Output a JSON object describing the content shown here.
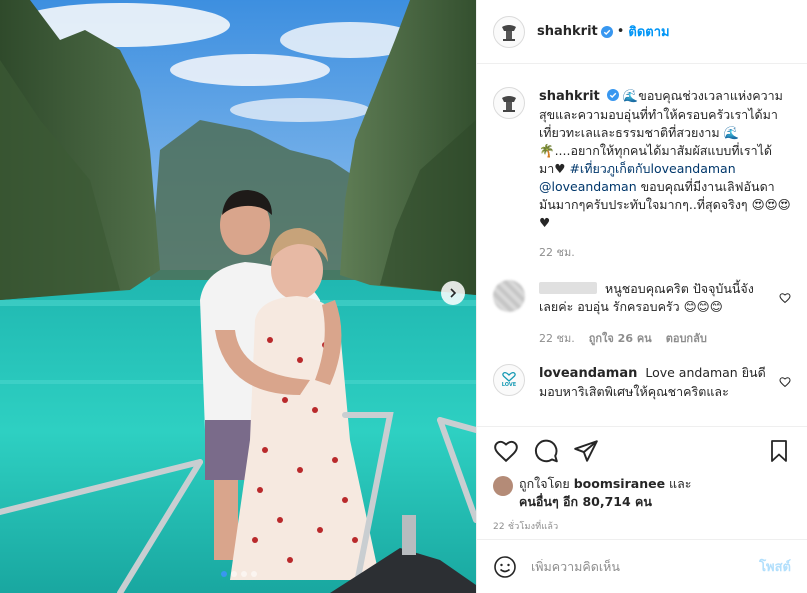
{
  "post": {
    "username": "shahkrit",
    "follow_label": "ติดตาม",
    "separator": "•",
    "caption_line1": "🌊ขอบคุณช่วงเวลาแห่งความสุขและความอบอุ่นที่ทำให้ครอบครัวเราได้มาเที่ยวทะเลและธรรมชาติที่สวยงาม",
    "caption_line2": "🌊🌴....อยากให้ทุกคนได้มาสัมผัสแบบที่เราได้มา♥",
    "caption_hashtag": "#เที่ยวภูเก็ตกับloveandaman",
    "caption_mention": "@loveandaman",
    "caption_line3": "ขอบคุณที่มีงานเลิฟอันดามันมากๆครับประทับใจมากๆ..ที่สุดจริงๆ",
    "caption_emojis": "😍😍😍♥",
    "caption_time": "22 ชม."
  },
  "comments": [
    {
      "text": "หนูชอบคุณคริต ปัจจุบันนี้จังเลยค่ะ อบอุ่น รักครอบครัว 😊😊😊",
      "time": "22 ชม.",
      "likes": "ถูกใจ 26 คน",
      "reply": "ตอบกลับ"
    },
    {
      "username": "loveandaman",
      "avatar_text": "LOVE",
      "text": "Love andaman ยินดีมอบหาริเสิตพิเศษให้คุณชาคริตและ"
    }
  ],
  "likes": {
    "prefix": "ถูกใจโดย",
    "user": "boomsiranee",
    "and": "และ",
    "others": "คนอื่นๆ อีก 80,714 คน"
  },
  "time_ago": "22 ชั่วโมงที่แล้ว",
  "add_comment": {
    "placeholder": "เพิ่มความคิดเห็น",
    "post_label": "โพสต์"
  },
  "icons": {
    "like": "heart-icon",
    "comment": "comment-icon",
    "share": "share-icon",
    "save": "bookmark-icon",
    "emoji": "emoji-icon",
    "verified": "verified-badge-icon",
    "next": "chevron-right-icon"
  },
  "colors": {
    "accent": "#0095f6",
    "verified": "#3897f0",
    "link": "#00376b",
    "muted": "#8e8e8e",
    "post_disabled": "#b2dffc"
  },
  "carousel": {
    "count": 4,
    "active": 1
  }
}
